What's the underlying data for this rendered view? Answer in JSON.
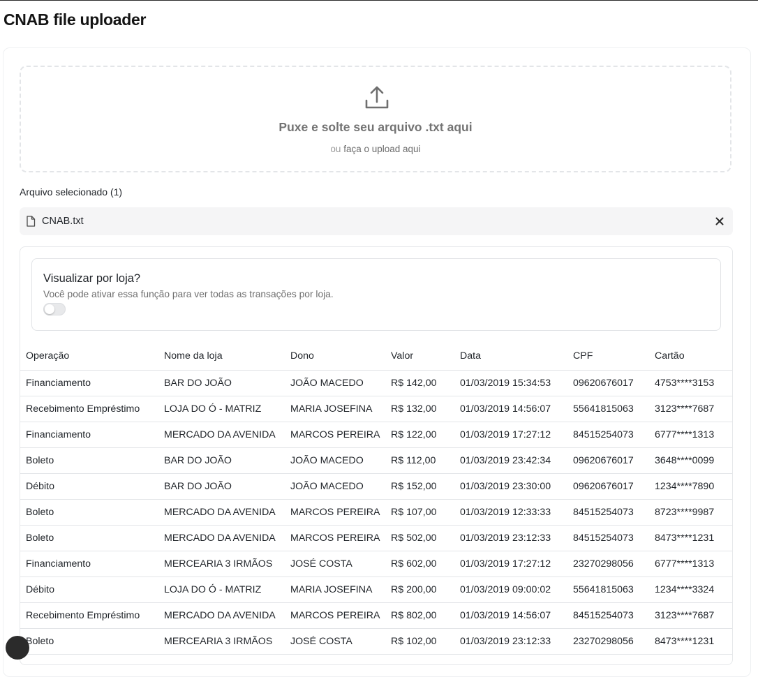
{
  "page": {
    "title": "CNAB file uploader"
  },
  "dropzone": {
    "main_text": "Puxe e solte seu arquivo .txt aqui",
    "sub_prefix": "ou",
    "sub_link": "faça o upload aqui",
    "icon": "upload-icon"
  },
  "selected": {
    "label": "Arquivo selecionado (1)",
    "file_name": "CNAB.txt",
    "file_icon": "file-icon",
    "remove_icon": "close-icon"
  },
  "store_view": {
    "title": "Visualizar por loja?",
    "description": "Você pode ativar essa função para ver todas as transações por loja.",
    "enabled": false
  },
  "table": {
    "columns": [
      "Operação",
      "Nome da loja",
      "Dono",
      "Valor",
      "Data",
      "CPF",
      "Cartão"
    ],
    "rows": [
      [
        "Financiamento",
        "BAR DO JOÃO",
        "JOÃO MACEDO",
        "R$ 142,00",
        "01/03/2019 15:34:53",
        "09620676017",
        "4753****3153"
      ],
      [
        "Recebimento Empréstimo",
        "LOJA DO Ó - MATRIZ",
        "MARIA JOSEFINA",
        "R$ 132,00",
        "01/03/2019 14:56:07",
        "55641815063",
        "3123****7687"
      ],
      [
        "Financiamento",
        "MERCADO DA AVENIDA",
        "MARCOS PEREIRA",
        "R$ 122,00",
        "01/03/2019 17:27:12",
        "84515254073",
        "6777****1313"
      ],
      [
        "Boleto",
        "BAR DO JOÃO",
        "JOÃO MACEDO",
        "R$ 112,00",
        "01/03/2019 23:42:34",
        "09620676017",
        "3648****0099"
      ],
      [
        "Débito",
        "BAR DO JOÃO",
        "JOÃO MACEDO",
        "R$ 152,00",
        "01/03/2019 23:30:00",
        "09620676017",
        "1234****7890"
      ],
      [
        "Boleto",
        "MERCADO DA AVENIDA",
        "MARCOS PEREIRA",
        "R$ 107,00",
        "01/03/2019 12:33:33",
        "84515254073",
        "8723****9987"
      ],
      [
        "Boleto",
        "MERCADO DA AVENIDA",
        "MARCOS PEREIRA",
        "R$ 502,00",
        "01/03/2019 23:12:33",
        "84515254073",
        "8473****1231"
      ],
      [
        "Financiamento",
        "MERCEARIA 3 IRMÃOS",
        "JOSÉ COSTA",
        "R$ 602,00",
        "01/03/2019 17:27:12",
        "23270298056",
        "6777****1313"
      ],
      [
        "Débito",
        "LOJA DO Ó - MATRIZ",
        "MARIA JOSEFINA",
        "R$ 200,00",
        "01/03/2019 09:00:02",
        "55641815063",
        "1234****3324"
      ],
      [
        "Recebimento Empréstimo",
        "MERCADO DA AVENIDA",
        "MARCOS PEREIRA",
        "R$ 802,00",
        "01/03/2019 14:56:07",
        "84515254073",
        "3123****7687"
      ],
      [
        "Boleto",
        "MERCEARIA 3 IRMÃOS",
        "JOSÉ COSTA",
        "R$ 102,00",
        "01/03/2019 23:12:33",
        "23270298056",
        "8473****1231"
      ]
    ]
  }
}
